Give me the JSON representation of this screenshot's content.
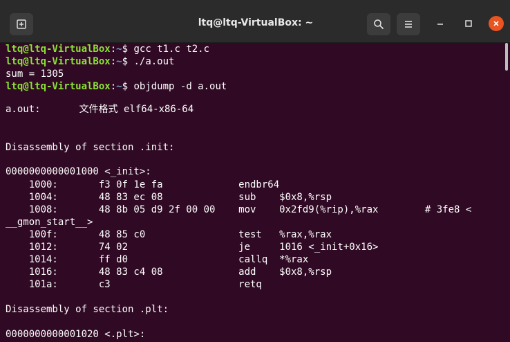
{
  "window": {
    "title": "ltq@ltq-VirtualBox: ~"
  },
  "icons": {
    "new_tab": "new-tab-icon",
    "search": "search-icon",
    "menu": "hamburger-menu-icon",
    "minimize": "minimize-icon",
    "maximize": "maximize-icon",
    "close": "close-icon"
  },
  "colors": {
    "terminal_bg": "#300a24",
    "titlebar_bg": "#2b2b2b",
    "prompt_user": "#8ae234",
    "prompt_path": "#729fcf",
    "text": "#ffffff",
    "close_button": "#e95420"
  },
  "terminal": {
    "prompt_user": "ltq@ltq-VirtualBox",
    "prompt_sep": ":",
    "prompt_path": "~",
    "prompt_symbol": "$",
    "commands": [
      " gcc t1.c t2.c",
      " ./a.out",
      " objdump -d a.out"
    ],
    "program_output": "sum = 1305",
    "file_header": {
      "name": "a.out:",
      "format_label": "文件格式",
      "format": " elf64-x86-64"
    },
    "section_init": "Disassembly of section .init:",
    "init_symbol": "0000000000001000 <_init>:",
    "disasm_lines": [
      "    1000:       f3 0f 1e fa             endbr64",
      "    1004:       48 83 ec 08             sub    $0x8,%rsp",
      "    1008:       48 8b 05 d9 2f 00 00    mov    0x2fd9(%rip),%rax        # 3fe8 <",
      "__gmon_start__>",
      "    100f:       48 85 c0                test   %rax,%rax",
      "    1012:       74 02                   je     1016 <_init+0x16>",
      "    1014:       ff d0                   callq  *%rax",
      "    1016:       48 83 c4 08             add    $0x8,%rsp",
      "    101a:       c3                      retq"
    ],
    "section_plt": "Disassembly of section .plt:",
    "plt_symbol": "0000000000001020 <.plt>:"
  }
}
